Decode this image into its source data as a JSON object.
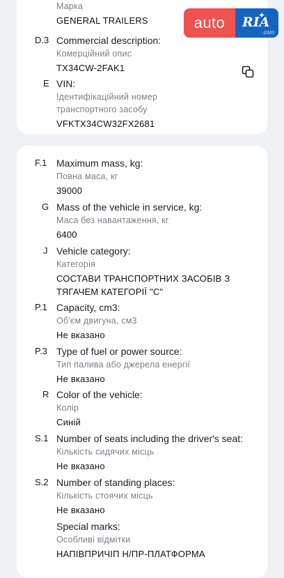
{
  "card1": {
    "brand": {
      "label_uk": "Марка",
      "value": "GENERAL TRAILERS"
    },
    "d3": {
      "code": "D.3",
      "title": "Commercial description:",
      "subtitle": "Комерційний опис",
      "value": "TX34CW-2FAK1"
    },
    "e": {
      "code": "E",
      "title": "VIN:",
      "subtitle_line1": "Ідентифікаційний номер",
      "subtitle_line2": "транспортного засобу",
      "value": "VFKTX34CW32FX2681",
      "copy_icon": "copy-icon"
    }
  },
  "card2": {
    "f1": {
      "code": "F.1",
      "title": "Maximum mass, kg:",
      "subtitle": "Повна маса, кг",
      "value": "39000"
    },
    "g": {
      "code": "G",
      "title": "Mass of the vehicle in service, kg:",
      "subtitle": "Маса без навантаження, кг",
      "value": "6400"
    },
    "j": {
      "code": "J",
      "title": "Vehicle category:",
      "subtitle": "Категорія",
      "value_line1": "СОСТАВИ ТРАНСПОРТНИХ ЗАСОБІВ З",
      "value_line2": "ТЯГАЧЕМ КАТЕГОРІЇ \"C\""
    },
    "p1": {
      "code": "P.1",
      "title": "Capacity, cm3:",
      "subtitle": "Об'єм двигуна, см3",
      "value": "Не вказано"
    },
    "p3": {
      "code": "P.3",
      "title": "Type of fuel or power source:",
      "subtitle": "Тип палива або джерела енергії",
      "value": "Не вказано"
    },
    "r": {
      "code": "R",
      "title": "Color of the vehicle:",
      "subtitle": "Колір",
      "value": "Синій"
    },
    "s1": {
      "code": "S.1",
      "title": "Number of seats including the driver's seat:",
      "subtitle": "Кількість сидячих місць",
      "value": "Не вказано"
    },
    "s2": {
      "code": "S.2",
      "title": "Number of standing places:",
      "subtitle": "Кількість стоячих місць",
      "value": "Не вказано"
    },
    "special": {
      "title": "Special marks:",
      "subtitle": "Особливі відмітки",
      "value": "НАПІВПРИЧІП Н/ПР-ПЛАТФОРМА"
    }
  },
  "logo": {
    "left_text": "auto",
    "right_text": "RIA",
    "suffix": ".com",
    "colors": {
      "left": "#ef5350",
      "right": "#1565c0"
    }
  }
}
